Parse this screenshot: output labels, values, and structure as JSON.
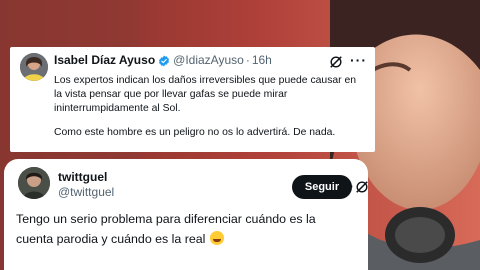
{
  "tweet_top": {
    "name": "Isabel Díaz Ayuso",
    "handle": "@IdiazAyuso",
    "separator": "·",
    "time": "16h",
    "paragraph1": "Los expertos indican los daños irreversibles que puede causar en la vista pensar que por llevar gafas se puede mirar ininterrumpidamente al Sol.",
    "paragraph2": "Como este hombre es un peligro no os lo advertirá. De nada."
  },
  "tweet_bottom": {
    "name": "twittguel",
    "handle": "@twittguel",
    "follow_label": "Seguir",
    "text": "Tengo un serio problema para diferenciar cuándo es la cuenta parodia y cuándo es la real"
  },
  "icons": {
    "verified": "verified-badge-icon",
    "grok": "grok-icon",
    "more": "more-options-icon",
    "emoji": "rofl-emoji-icon"
  },
  "colors": {
    "verified_blue": "#1d9bf0",
    "text_primary": "#0f1419",
    "text_secondary": "#536471",
    "follow_button": "#0f1419"
  }
}
